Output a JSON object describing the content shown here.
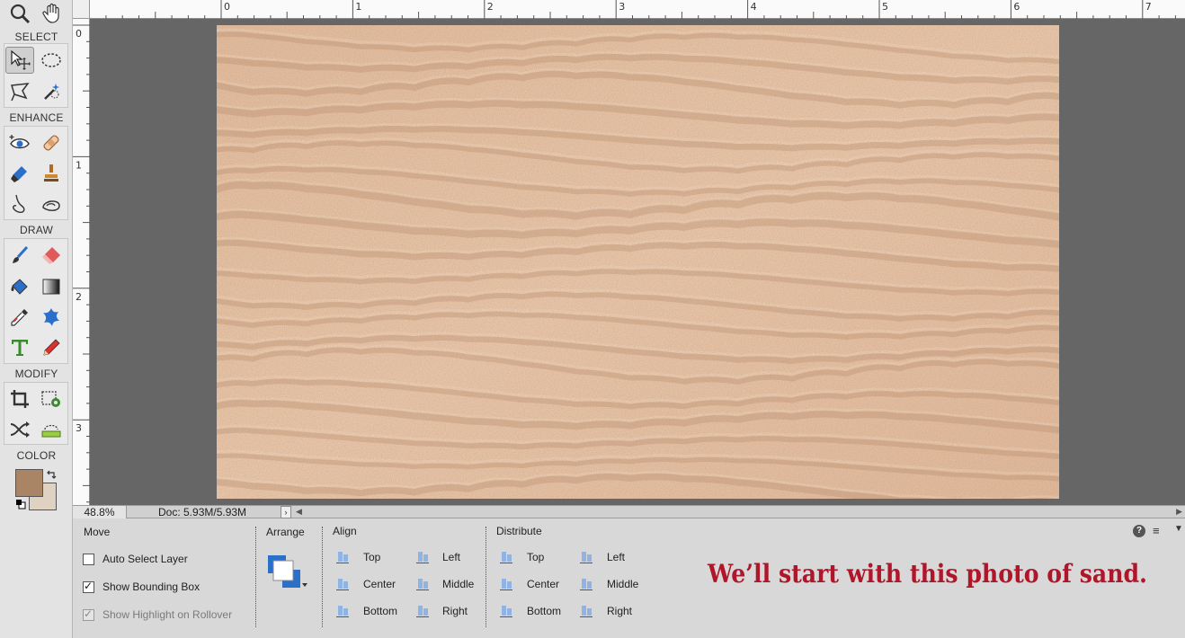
{
  "toolbox": {
    "sections": {
      "select": "SELECT",
      "enhance": "ENHANCE",
      "draw": "DRAW",
      "modify": "MODIFY",
      "color": "COLOR"
    },
    "foreground_color": "#a98465",
    "background_color": "#e0d2c2",
    "tools": [
      {
        "name": "zoom-tool",
        "icon": "magnifier-icon"
      },
      {
        "name": "hand-tool",
        "icon": "hand-icon"
      },
      {
        "name": "move-tool",
        "icon": "move-icon",
        "selected": true
      },
      {
        "name": "elliptical-marquee-tool",
        "icon": "ellipse-marquee-icon"
      },
      {
        "name": "lasso-tool",
        "icon": "polygonal-lasso-icon"
      },
      {
        "name": "quick-selection-tool",
        "icon": "magic-wand-icon"
      },
      {
        "name": "red-eye-tool",
        "icon": "eye-icon"
      },
      {
        "name": "spot-healing-tool",
        "icon": "bandage-icon"
      },
      {
        "name": "smart-brush-tool",
        "icon": "smart-brush-icon"
      },
      {
        "name": "clone-stamp-tool",
        "icon": "stamp-icon"
      },
      {
        "name": "blur-tool",
        "icon": "finger-icon"
      },
      {
        "name": "sponge-tool",
        "icon": "sponge-icon"
      },
      {
        "name": "brush-tool",
        "icon": "brush-icon"
      },
      {
        "name": "eraser-tool",
        "icon": "eraser-icon"
      },
      {
        "name": "paint-bucket-tool",
        "icon": "bucket-icon"
      },
      {
        "name": "gradient-tool",
        "icon": "gradient-icon"
      },
      {
        "name": "eyedropper-tool",
        "icon": "eyedropper-icon"
      },
      {
        "name": "custom-shape-tool",
        "icon": "shape-icon"
      },
      {
        "name": "type-tool",
        "icon": "type-icon"
      },
      {
        "name": "pencil-tool",
        "icon": "pencil-icon"
      },
      {
        "name": "crop-tool",
        "icon": "crop-icon"
      },
      {
        "name": "recompose-tool",
        "icon": "recompose-icon"
      },
      {
        "name": "content-aware-move-tool",
        "icon": "content-move-icon"
      },
      {
        "name": "straighten-tool",
        "icon": "level-icon"
      }
    ]
  },
  "rulers": {
    "top_labels": [
      "0",
      "1",
      "2",
      "3",
      "4",
      "5",
      "6",
      "7"
    ],
    "left_labels": [
      "0",
      "1",
      "2",
      "3"
    ]
  },
  "canvas": {
    "background": "#666666",
    "photo_description_color": "#e6bf9f"
  },
  "status": {
    "zoom": "48.8%",
    "doc": "Doc: 5.93M/5.93M",
    "arrow": "›"
  },
  "options": {
    "move": {
      "title": "Move",
      "auto_select": {
        "label": "Auto Select Layer",
        "checked": false
      },
      "bounding_box": {
        "label": "Show Bounding Box",
        "checked": true
      },
      "highlight": {
        "label": "Show Highlight on Rollover",
        "checked": true,
        "disabled": true
      }
    },
    "arrange": {
      "title": "Arrange"
    },
    "align": {
      "title": "Align",
      "top": "Top",
      "center": "Center",
      "bottom": "Bottom",
      "left": "Left",
      "middle": "Middle",
      "right": "Right"
    },
    "distribute": {
      "title": "Distribute",
      "top": "Top",
      "center": "Center",
      "bottom": "Bottom",
      "left": "Left",
      "middle": "Middle",
      "right": "Right"
    },
    "help": "?",
    "menu": "≡"
  },
  "caption": "We’ll start with this photo of sand."
}
